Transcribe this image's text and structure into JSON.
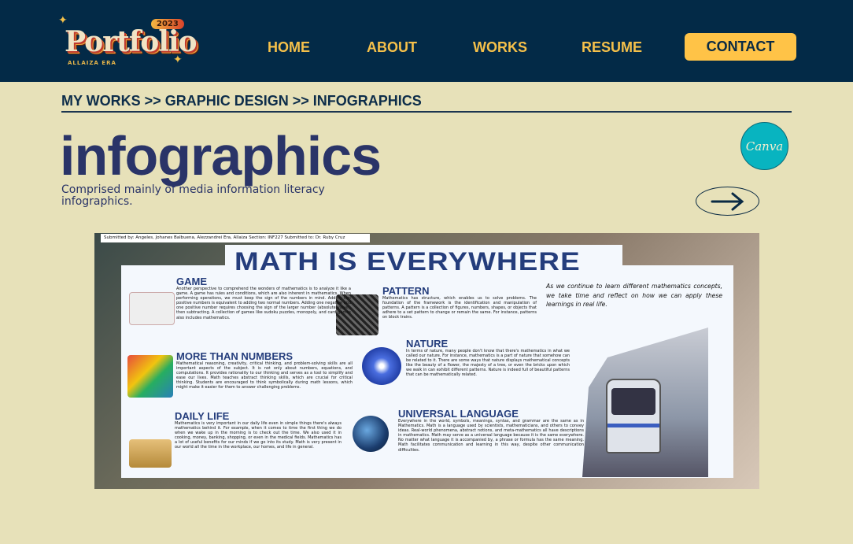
{
  "header": {
    "logo": {
      "word": "Portfolio",
      "year": "2023",
      "subtitle": "ALLAIZA ERA"
    },
    "nav": [
      {
        "label": "HOME"
      },
      {
        "label": "ABOUT"
      },
      {
        "label": "WORKS"
      },
      {
        "label": "RESUME"
      }
    ],
    "contact_label": "CONTACT"
  },
  "breadcrumb": "MY WORKS >> GRAPHIC DESIGN >> INFOGRAPHICS",
  "page_title": "infographics",
  "description": "Comprised mainly of media information literacy infographics.",
  "canva_label": "Canva",
  "next_icon": "arrow-right-icon",
  "infographic": {
    "submitted_bar": "Submitted by: Angeles, Johanes     Balbuena, Alezzandrei     Era, Allaiza     Section: INF227     Submitted to:  Dr. Ruby Cruz",
    "title": "MATH IS EVERYWHERE",
    "quote": "As we continue to learn different mathematics concepts, we take time and reflect on how we can apply these learnings in real life.",
    "sections": [
      {
        "heading": "GAME",
        "text": "Another perspective to comprehend the wonders of mathematics is to analyze it like a game. A game has rules and conditions, which are also inherent in mathematics. When performing operations, we must keep the sign of the numbers in mind. Adding two positive numbers is equivalent to adding two normal numbers. Adding one negative and one positive number requires choosing the sign of the larger number (absolute value), then subtracting. A collection of games like sudoku puzzles, monopoly, and card games also includes mathematics."
      },
      {
        "heading": "MORE THAN NUMBERS",
        "text": "Mathematical reasoning, creativity, critical thinking, and problem-solving skills are all important aspects of the subject. It is not only about numbers, equations, and computations. It provides rationality to our thinking and serves as a tool to simplify and ease our lives. Math teaches abstract thinking skills, which are crucial for critical thinking. Students are encouraged to think symbolically during math lessons, which might make it easier for them to answer challenging problems."
      },
      {
        "heading": "DAILY LIFE",
        "text": "Mathematics is very important in our daily life even in simple things there's always mathematics behind it. For example, when it comes to time the first thing we do when we wake up in the morning is to check out the time. We also used it in cooking, money, banking, shopping, or even in the medical fields. Mathematics has a lot of useful benefits for our minds if we go into its study. Math is very present in our world all the time in the workplace, our homes, and life in general."
      },
      {
        "heading": "PATTERN",
        "text": "Mathematics has structure, which enables us to solve problems. The foundation of the framework is the identification and manipulation of patterns. A pattern is a collection of figures, numbers, shapes, or objects that adhere to a set pattern to change or remain the same. For instance, patterns on block trains."
      },
      {
        "heading": "NATURE",
        "text": "In terms of nature, many people don't know that there's mathematics in what we called our nature. For instance, mathematics is a part of nature that somehow can be related to it. There are some ways that nature displays mathematical concepts like the beauty of a flower, the majesty of a tree, or even the bricks upon which we walk in can exhibit different patterns. Nature is indeed full of beautiful patterns that can be mathematically related."
      },
      {
        "heading": "UNIVERSAL LANGUAGE",
        "text": "Everywhere in the world, symbols, meanings, syntax, and grammar are the same as in Mathematics. Math is a language used by scientists, mathematicians, and others to convey ideas. Real-world phenomena, abstract notions, and meta-mathematics all have descriptions in mathematics. Math may serve as a universal language because it is the same everywhere. No matter what language it is accompanied by, a phrase or formula has the same meaning. Math facilitates communication and learning in this way, despite other communication difficulties."
      }
    ]
  },
  "colors": {
    "header_bg": "#032a47",
    "page_bg": "#e7e1b9",
    "accent": "#ffc347",
    "title": "#2a3468",
    "canva": "#08b4c0"
  }
}
